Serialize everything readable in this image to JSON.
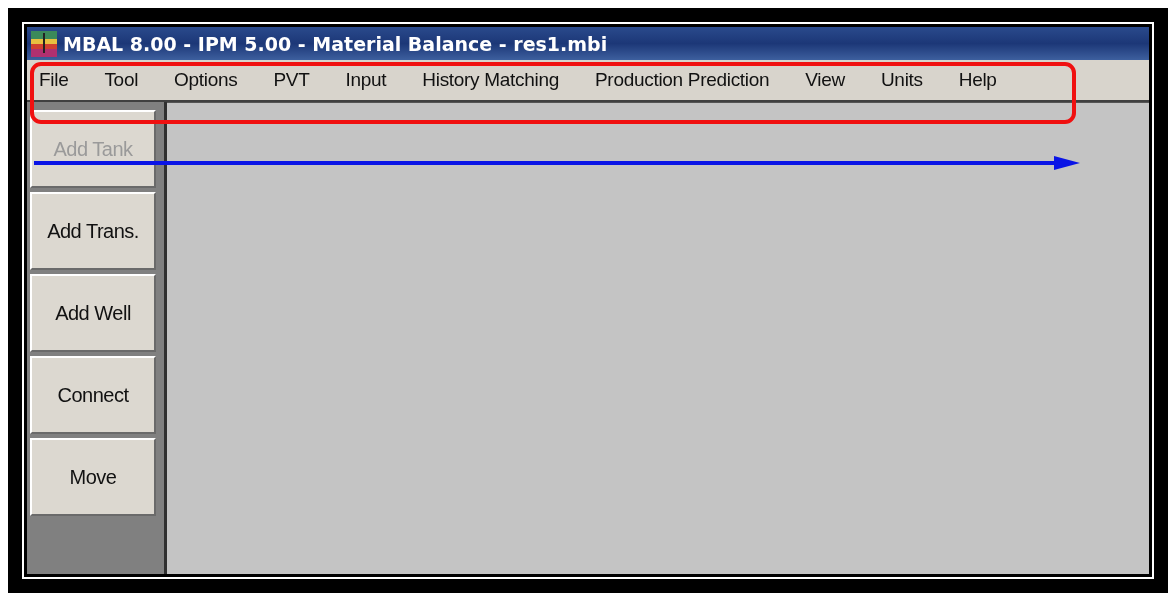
{
  "window": {
    "title": "MBAL 8.00 - IPM 5.00 - Material Balance - res1.mbi"
  },
  "menu": [
    "File",
    "Tool",
    "Options",
    "PVT",
    "Input",
    "History Matching",
    "Production Prediction",
    "View",
    "Units",
    "Help"
  ],
  "toolbar": [
    {
      "label": "Add Tank",
      "disabled": true
    },
    {
      "label": "Add Trans.",
      "disabled": false
    },
    {
      "label": "Add Well",
      "disabled": false
    },
    {
      "label": "Connect",
      "disabled": false
    },
    {
      "label": "Move",
      "disabled": false
    }
  ]
}
